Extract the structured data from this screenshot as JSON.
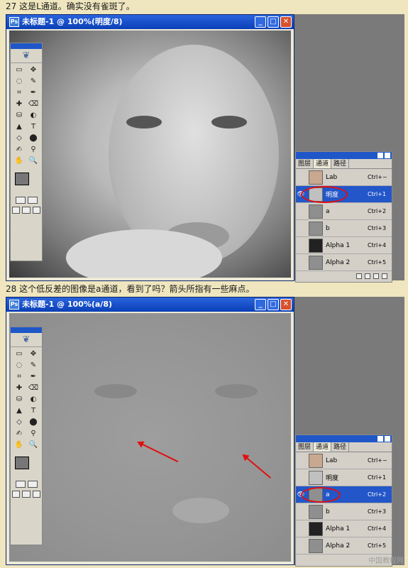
{
  "step1": {
    "caption": "27 这是L通道。确实没有雀斑了。",
    "window_title": "未标题-1 @ 100%(明度/8)",
    "channels": [
      {
        "name": "Lab",
        "key": "Ctrl+~",
        "thumb": "#c9a890",
        "eye": ""
      },
      {
        "name": "明度",
        "key": "Ctrl+1",
        "thumb": "#c0c0c0",
        "eye": "👁"
      },
      {
        "name": "a",
        "key": "Ctrl+2",
        "thumb": "#8f8f8f",
        "eye": ""
      },
      {
        "name": "b",
        "key": "Ctrl+3",
        "thumb": "#8f8f8f",
        "eye": ""
      },
      {
        "name": "Alpha 1",
        "key": "Ctrl+4",
        "thumb": "#222222",
        "eye": ""
      },
      {
        "name": "Alpha 2",
        "key": "Ctrl+5",
        "thumb": "#8f8f8f",
        "eye": ""
      }
    ],
    "selected_index": 1
  },
  "step2": {
    "caption": "28 这个低反差的图像是a通道，看到了吗？箭头所指有一些麻点。",
    "window_title": "未标题-1 @ 100%(a/8)",
    "channels": [
      {
        "name": "Lab",
        "key": "Ctrl+~",
        "thumb": "#c9a890",
        "eye": ""
      },
      {
        "name": "明度",
        "key": "Ctrl+1",
        "thumb": "#c0c0c0",
        "eye": ""
      },
      {
        "name": "a",
        "key": "Ctrl+2",
        "thumb": "#8f8f8f",
        "eye": "👁"
      },
      {
        "name": "b",
        "key": "Ctrl+3",
        "thumb": "#8f8f8f",
        "eye": ""
      },
      {
        "name": "Alpha 1",
        "key": "Ctrl+4",
        "thumb": "#222222",
        "eye": ""
      },
      {
        "name": "Alpha 2",
        "key": "Ctrl+5",
        "thumb": "#8f8f8f",
        "eye": ""
      }
    ],
    "selected_index": 2,
    "watermark": "中国教程网"
  },
  "panel_tabs": [
    "图层",
    "通道",
    "路径"
  ],
  "window_buttons": [
    "_",
    "□",
    "✕"
  ],
  "tools": [
    "▭",
    "✥",
    "◌",
    "✎",
    "⌗",
    "✒",
    "✚",
    "⌫",
    "⛁",
    "◐",
    "▲",
    "T",
    "◇",
    "⬤",
    "✍",
    "⚲",
    "✋",
    "🔍"
  ],
  "colors": {
    "accent": "#2356c8",
    "highlight": "#e01010"
  }
}
